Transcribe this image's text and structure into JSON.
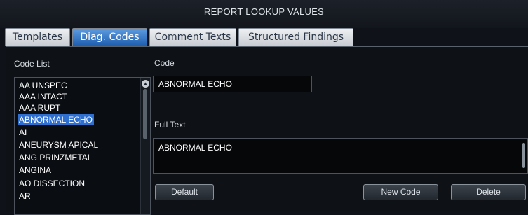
{
  "window": {
    "title": "REPORT LOOKUP VALUES"
  },
  "tabs": [
    {
      "label": "Templates",
      "active": false
    },
    {
      "label": "Diag. Codes",
      "active": true
    },
    {
      "label": "Comment Texts",
      "active": false
    },
    {
      "label": "Structured Findings",
      "active": false
    }
  ],
  "code_list": {
    "label": "Code List",
    "items": [
      "AA UNSPEC",
      "AAA INTACT",
      "AAA RUPT",
      "ABNORMAL ECHO",
      "AI",
      "ANEURYSM APICAL",
      "ANG PRINZMETAL",
      "ANGINA",
      "AO DISSECTION",
      "AR"
    ],
    "selected": "ABNORMAL ECHO"
  },
  "code": {
    "label": "Code",
    "value": "ABNORMAL ECHO"
  },
  "full_text": {
    "label": "Full Text",
    "value": "ABNORMAL ECHO"
  },
  "buttons": {
    "default_label": "Default",
    "new_code_label": "New Code",
    "delete_label": "Delete"
  },
  "colors": {
    "background": "#0f1319",
    "active_tab": "#2f6fd0",
    "selection": "#2f6fd0",
    "tab_inactive": "#d9dde2"
  }
}
